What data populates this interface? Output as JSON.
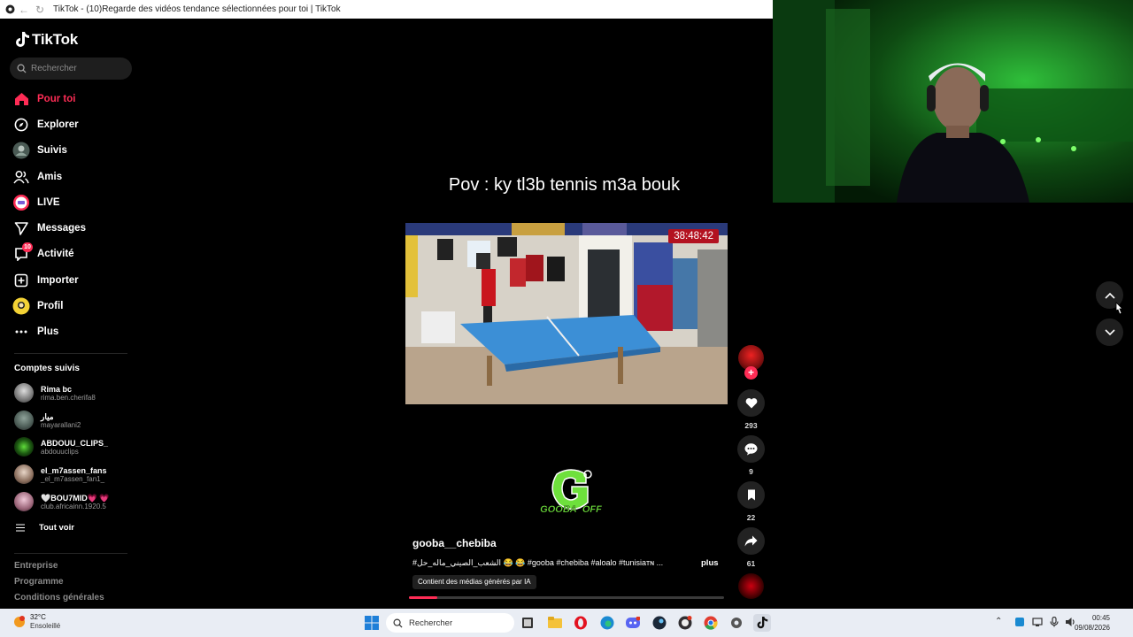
{
  "browser": {
    "title": "TikTok - (10)Regarde des vidéos tendance sélectionnées pour toi | TikTok"
  },
  "sidebar": {
    "logo_text": "TikTok",
    "search_placeholder": "Rechercher",
    "nav": [
      {
        "label": "Pour toi",
        "icon": "home-icon",
        "active": true
      },
      {
        "label": "Explorer",
        "icon": "compass-icon"
      },
      {
        "label": "Suivis",
        "icon": "following-avatar-icon"
      },
      {
        "label": "Amis",
        "icon": "friends-icon"
      },
      {
        "label": "LIVE",
        "icon": "live-icon"
      },
      {
        "label": "Messages",
        "icon": "messages-icon"
      },
      {
        "label": "Activité",
        "icon": "activity-icon",
        "badge": "10"
      },
      {
        "label": "Importer",
        "icon": "upload-icon"
      },
      {
        "label": "Profil",
        "icon": "profile-avatar-icon"
      },
      {
        "label": "Plus",
        "icon": "more-icon"
      }
    ],
    "followed_title": "Comptes suivis",
    "accounts": [
      {
        "name": "Rima bc",
        "handle": "rima.ben.cherifa8"
      },
      {
        "name": "ميار",
        "handle": "mayarallani2"
      },
      {
        "name": "ABDOUU_CLIPS_",
        "handle": "abdouuclips"
      },
      {
        "name": "el_m7assen_fans",
        "handle": "_el_m7assen_fan1_"
      },
      {
        "name": "🤍BOU7MID💗 💗",
        "handle": "club.africainn.1920.5"
      }
    ],
    "see_all": "Tout voir",
    "footer": [
      "Entreprise",
      "Programme",
      "Conditions générales"
    ]
  },
  "video": {
    "caption_title": "Pov : ky tl3b tennis m3a bouk",
    "timer": "38:48:42",
    "author": "gooba__chebiba",
    "description": "#الشعب_الصيني_ماله_حل 😂 😂 #gooba #chebiba #aloalo #tunisiaᴛɴ ...",
    "more_label": "plus",
    "ai_label": "Contient des médias générés par IA",
    "progress_fraction": 0.09,
    "logo_text": "GOOBA_OFF"
  },
  "actions": {
    "likes": "293",
    "comments": "9",
    "saves": "22",
    "shares": "61"
  },
  "taskbar": {
    "temp": "32°C",
    "weather": "Ensoleillé",
    "search": "Rechercher",
    "time": "00:45",
    "date": "09/08/2026"
  },
  "colors": {
    "accent": "#fe2c55",
    "background": "#000000",
    "taskbar": "#e9edf4"
  }
}
